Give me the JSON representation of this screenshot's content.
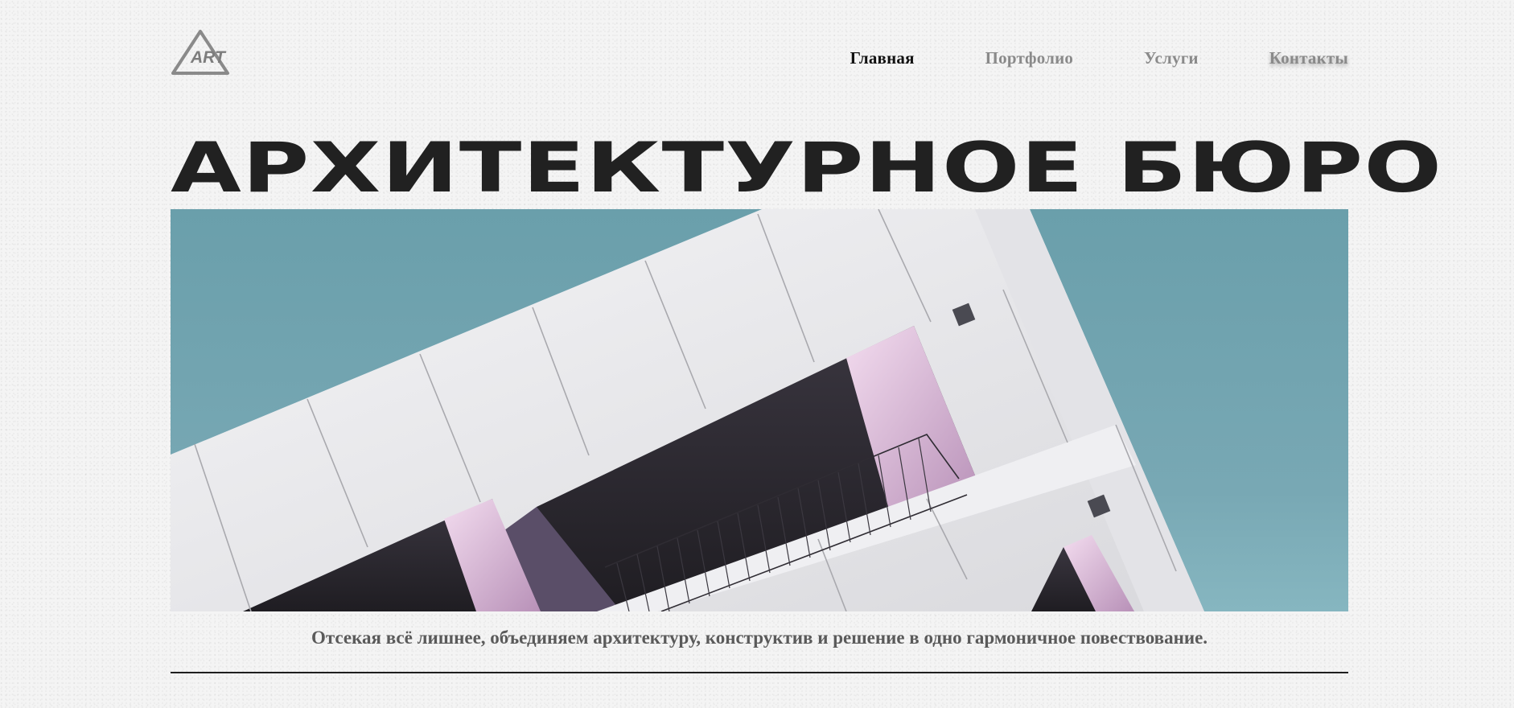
{
  "logo": {
    "text": "ART"
  },
  "nav": {
    "items": [
      {
        "label": "Главная",
        "active": true
      },
      {
        "label": "Портфолио",
        "active": false
      },
      {
        "label": "Услуги",
        "active": false
      },
      {
        "label": "Контакты",
        "active": false
      }
    ]
  },
  "hero": {
    "title": "АРХИТЕКТУРНОЕ БЮРО",
    "tagline": "Отсекая всё лишнее, объединяем архитектуру, конструктив и решение в одно гармоничное повествование."
  },
  "colors": {
    "sky": "#6fa3ae",
    "title": "#212121",
    "nav_active": "#111111",
    "nav_inactive": "#8a8a8a",
    "accent_pink": "#d9b8d8"
  }
}
